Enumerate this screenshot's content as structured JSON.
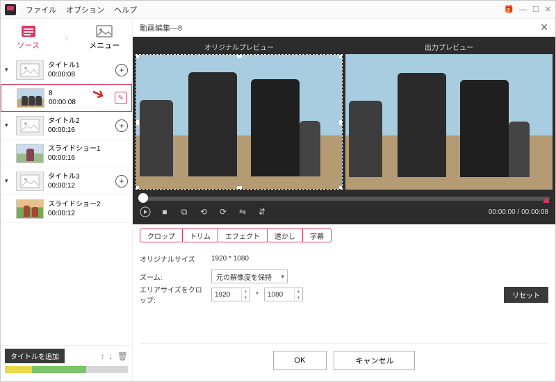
{
  "menubar": {
    "file": "ファイル",
    "option": "オプション",
    "help": "ヘルプ"
  },
  "window": {
    "gift": "🎁",
    "min": "—",
    "max": "☐",
    "close": "✕"
  },
  "lefttabs": {
    "source": "ソース",
    "menu": "メニュー"
  },
  "titles": [
    {
      "name": "タイトル1",
      "dur": "00:00:08",
      "items": [
        {
          "name": "8",
          "dur": "00:00:08",
          "selected": true
        }
      ]
    },
    {
      "name": "タイトル2",
      "dur": "00:00:16",
      "items": [
        {
          "name": "スライドショー1",
          "dur": "00:00:16"
        }
      ]
    },
    {
      "name": "タイトル3",
      "dur": "00:00:12",
      "items": [
        {
          "name": "スライドショー2",
          "dur": "00:00:12"
        }
      ]
    }
  ],
  "leftfoot": {
    "addtitle": "タイトルを追加"
  },
  "edit": {
    "title": "動画編集—8",
    "original_label": "オリジナルプレビュー",
    "output_label": "出力プレビュー",
    "time": "00:00:00 / 00:00:08",
    "tabs": [
      "クロップ",
      "トリム",
      "エフェクト",
      "透かし",
      "字幕"
    ],
    "rows": {
      "origsize_lbl": "オリジナルサイズ",
      "origsize_val": "1920 * 1080",
      "zoom_lbl": "ズーム:",
      "zoom_val": "元の解像度を保持",
      "crop_lbl": "エリアサイズをクロップ:",
      "crop_w": "1920",
      "crop_h": "1080",
      "star": "*"
    },
    "reset": "リセット",
    "ok": "OK",
    "cancel": "キャンセル"
  }
}
